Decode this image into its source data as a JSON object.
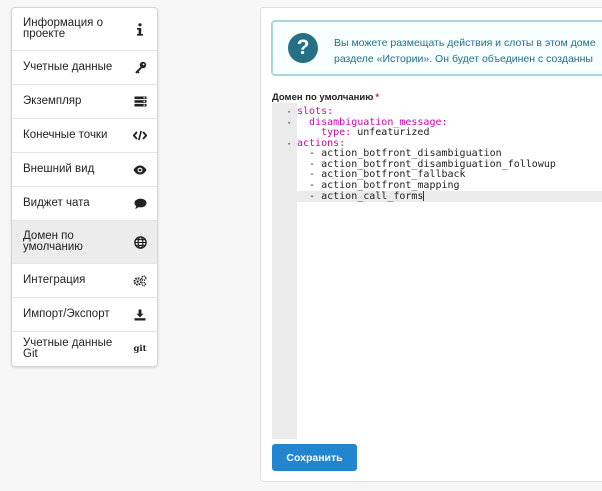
{
  "sidebar": {
    "items": [
      {
        "label": "Информация о проекте",
        "icon": "info-icon",
        "active": false
      },
      {
        "label": "Учетные данные",
        "icon": "key-icon",
        "active": false
      },
      {
        "label": "Экземпляр",
        "icon": "server-icon",
        "active": false
      },
      {
        "label": "Конечные точки",
        "icon": "code-icon",
        "active": false
      },
      {
        "label": "Внешний вид",
        "icon": "eye-icon",
        "active": false
      },
      {
        "label": "Виджет чата",
        "icon": "chat-icon",
        "active": false
      },
      {
        "label": "Домен по умолчанию",
        "icon": "globe-icon",
        "active": true
      },
      {
        "label": "Интеграция",
        "icon": "cogs-icon",
        "active": false
      },
      {
        "label": "Импорт/Экспорт",
        "icon": "download-icon",
        "active": false
      },
      {
        "label": "Учетные данные Git",
        "icon": "git-icon",
        "active": false
      }
    ],
    "git_icon_text": "git"
  },
  "info_message": {
    "icon": "question-icon",
    "icon_text": "?",
    "line1": "Вы можете размещать действия и слоты в этом доме",
    "line2": "разделе «Истории». Он будет объединен с созданны"
  },
  "domain_field": {
    "label": "Домен по умолчанию",
    "required_mark": "*"
  },
  "editor": {
    "lines": [
      {
        "text": "slots:",
        "style": "key",
        "indent": "",
        "fold": true
      },
      {
        "text": "disambiguation_message:",
        "style": "key",
        "indent": "  ",
        "fold": true
      },
      {
        "text_key": "type:",
        "text_val": " unfeaturized",
        "style": "pair",
        "indent": "    ",
        "fold": false
      },
      {
        "text": "actions:",
        "style": "key",
        "indent": "",
        "fold": true
      },
      {
        "text": "- action_botfront_disambiguation",
        "style": "plain",
        "indent": "  ",
        "fold": false
      },
      {
        "text": "- action_botfront_disambiguation_followup",
        "style": "plain",
        "indent": "  ",
        "fold": false
      },
      {
        "text": "- action_botfront_fallback",
        "style": "plain",
        "indent": "  ",
        "fold": false
      },
      {
        "text": "- action_botfront_mapping",
        "style": "plain",
        "indent": "  ",
        "fold": false
      },
      {
        "text": "- action_call_forms",
        "style": "plain",
        "indent": "  ",
        "fold": false,
        "active": true
      }
    ]
  },
  "save_button": {
    "label": "Сохранить"
  },
  "colors": {
    "primary": "#2185d0",
    "info_text": "#276f86",
    "info_bg": "#f8ffff",
    "yaml_key": "#c70aa6",
    "required": "#db2828"
  }
}
